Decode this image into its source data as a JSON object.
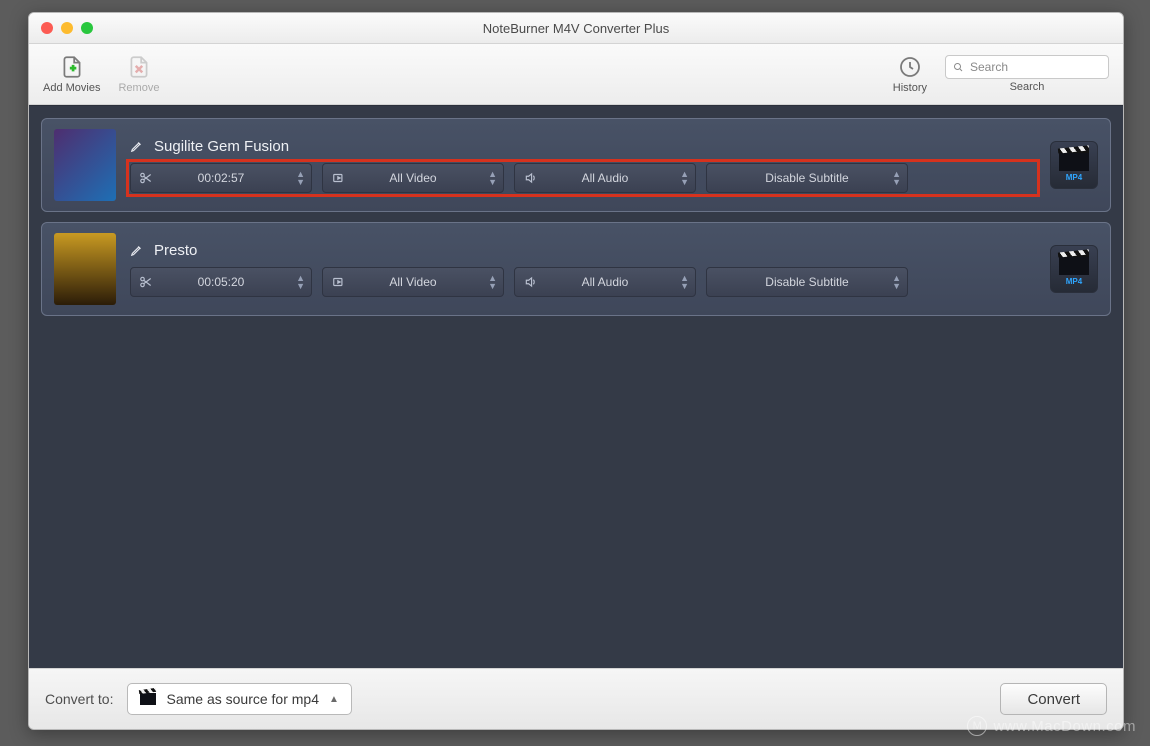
{
  "window": {
    "title": "NoteBurner M4V Converter Plus"
  },
  "toolbar": {
    "add_movies_label": "Add Movies",
    "remove_label": "Remove",
    "history_label": "History",
    "search_label": "Search",
    "search_placeholder": "Search"
  },
  "rows": [
    {
      "title": "Sugilite Gem Fusion",
      "duration": "00:02:57",
      "video_sel": "All Video",
      "audio_sel": "All Audio",
      "subtitle_sel": "Disable Subtitle",
      "highlighted": true
    },
    {
      "title": "Presto",
      "duration": "00:05:20",
      "video_sel": "All Video",
      "audio_sel": "All Audio",
      "subtitle_sel": "Disable Subtitle",
      "highlighted": false
    }
  ],
  "bottom": {
    "convert_to_label": "Convert to:",
    "preset_label": "Same as source for mp4",
    "convert_button": "Convert"
  },
  "watermark": "www.MacDown.com"
}
